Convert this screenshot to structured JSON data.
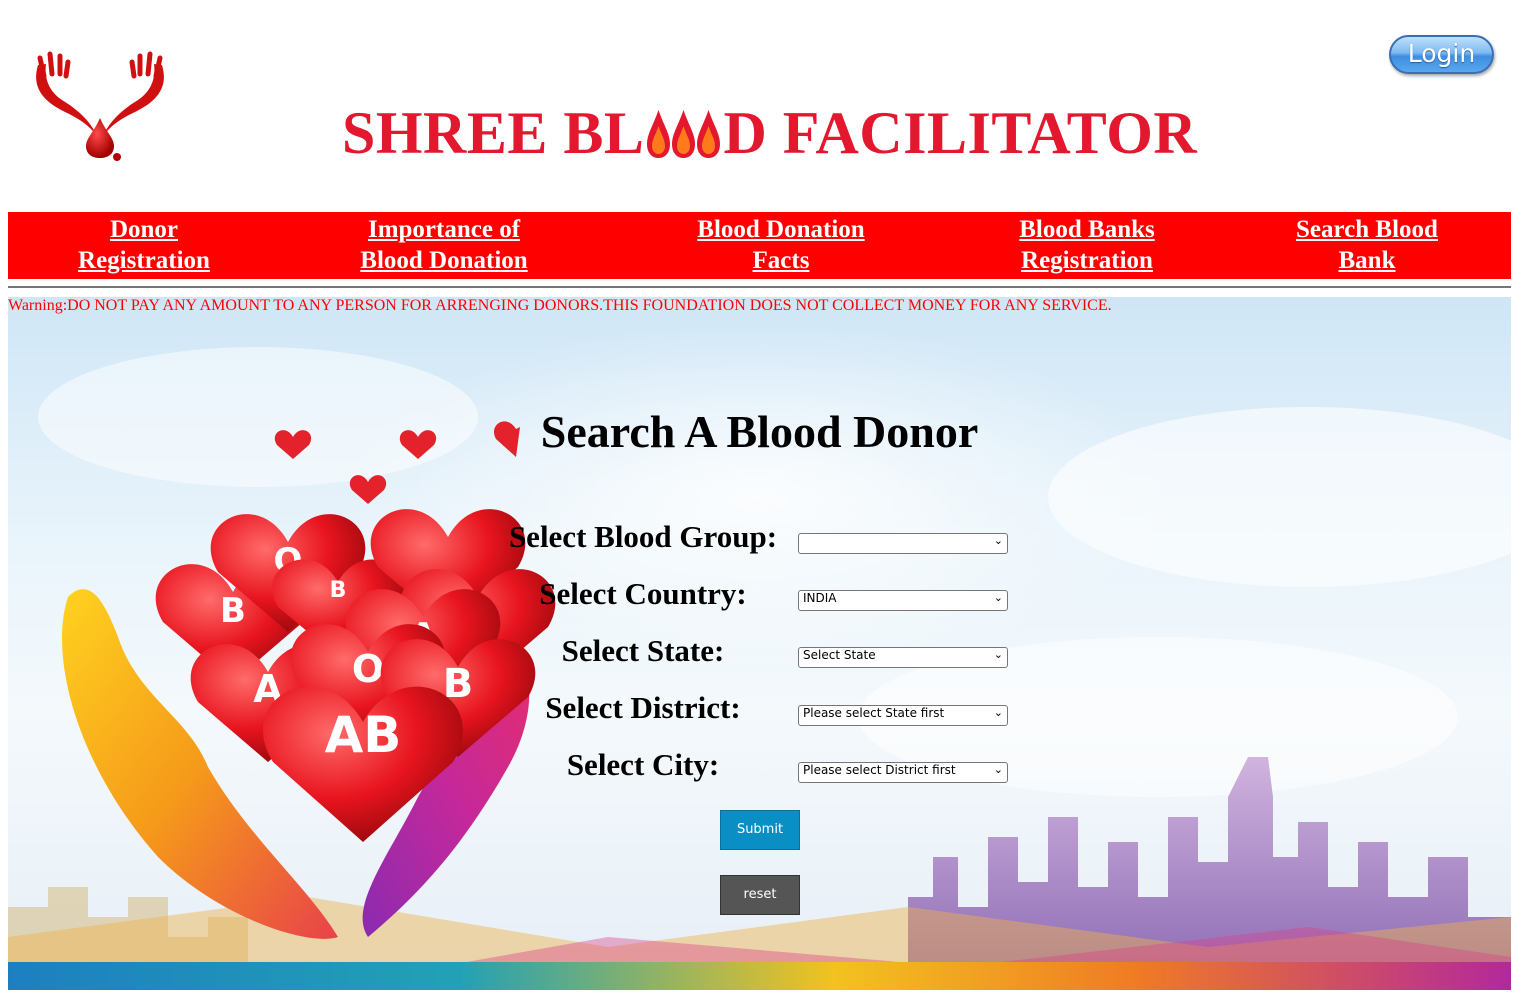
{
  "header": {
    "login_label": "Login",
    "title_before": "SHREE BL",
    "title_after": "D FACILITATOR"
  },
  "nav": {
    "items": [
      {
        "label": "Donor\nRegistration"
      },
      {
        "label": "Importance of\nBlood Donation"
      },
      {
        "label": "Blood Donation\nFacts"
      },
      {
        "label": "Blood Banks\nRegistration"
      },
      {
        "label": "Search Blood\nBank"
      }
    ]
  },
  "warning": "Warning:DO NOT PAY ANY AMOUNT TO ANY PERSON FOR ARRENGING DONORS.THIS FOUNDATION DOES NOT COLLECT MONEY FOR ANY SERVICE.",
  "search": {
    "title": "Search A Blood Donor",
    "fields": [
      {
        "label": "Select Blood Group:",
        "value": ""
      },
      {
        "label": "Select Country:",
        "value": "INDIA"
      },
      {
        "label": "Select State:",
        "value": "Select State"
      },
      {
        "label": "Select District:",
        "value": "Please select State first"
      },
      {
        "label": "Select City:",
        "value": "Please select District first"
      }
    ],
    "submit_label": "Submit",
    "reset_label": "reset"
  },
  "hero_art": {
    "heart_letters": [
      "O",
      "B",
      "B",
      "A",
      "A",
      "B",
      "O",
      "B",
      "A",
      "AB"
    ]
  },
  "colors": {
    "brand_red": "#e3172d",
    "nav_red": "#ff0000",
    "submit_blue": "#0a8fc4",
    "reset_gray": "#555555"
  }
}
